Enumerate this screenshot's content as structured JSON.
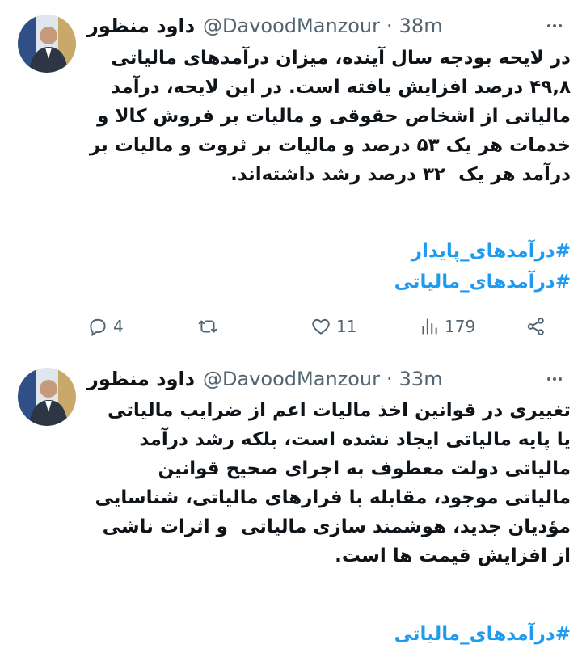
{
  "tweets": [
    {
      "author_name": "داود منظور",
      "handle": "@DavoodManzour",
      "separator": "·",
      "time": "38m",
      "text": "در لایحه بودجه سال آینده، میزان درآمدهای مالیاتی ۴۹,۸ درصد افزایش یافته است. در این لایحه، درآمد مالیاتی از اشخاص حقوقی و مالیات بر فروش کالا و خدمات هر یک ۵۳ درصد و مالیات بر ثروت و مالیات بر درآمد هر یک  ۳۲ درصد رشد داشته‌اند.",
      "hashtags": [
        "#درآمدهای_پایدار",
        "#درآمدهای_مالیاتی"
      ],
      "replies": "4",
      "retweets": "",
      "likes": "11",
      "views": "179"
    },
    {
      "author_name": "داود منظور",
      "handle": "@DavoodManzour",
      "separator": "·",
      "time": "33m",
      "text": "تغییری در قوانین اخذ مالیات اعم از ضرایب مالیاتی یا پایه مالیاتی ایجاد نشده است، بلکه رشد درآمد مالیاتی دولت معطوف به اجرای صحیح قوانین مالیاتی موجود، مقابله با فرارهای مالیاتی، شناسایی مؤدیان جدید، هوشمند سازی مالیاتی  و اثرات ناشی از افزایش قیمت ها است.",
      "hashtags": [
        "#درآمدهای_مالیاتی"
      ]
    }
  ],
  "icons": {
    "reply": "reply-icon",
    "retweet": "retweet-icon",
    "like": "heart-icon",
    "views": "views-icon",
    "share": "share-icon",
    "more": "more-icon"
  },
  "colors": {
    "link": "#1d9bf0",
    "muted": "#536471"
  }
}
